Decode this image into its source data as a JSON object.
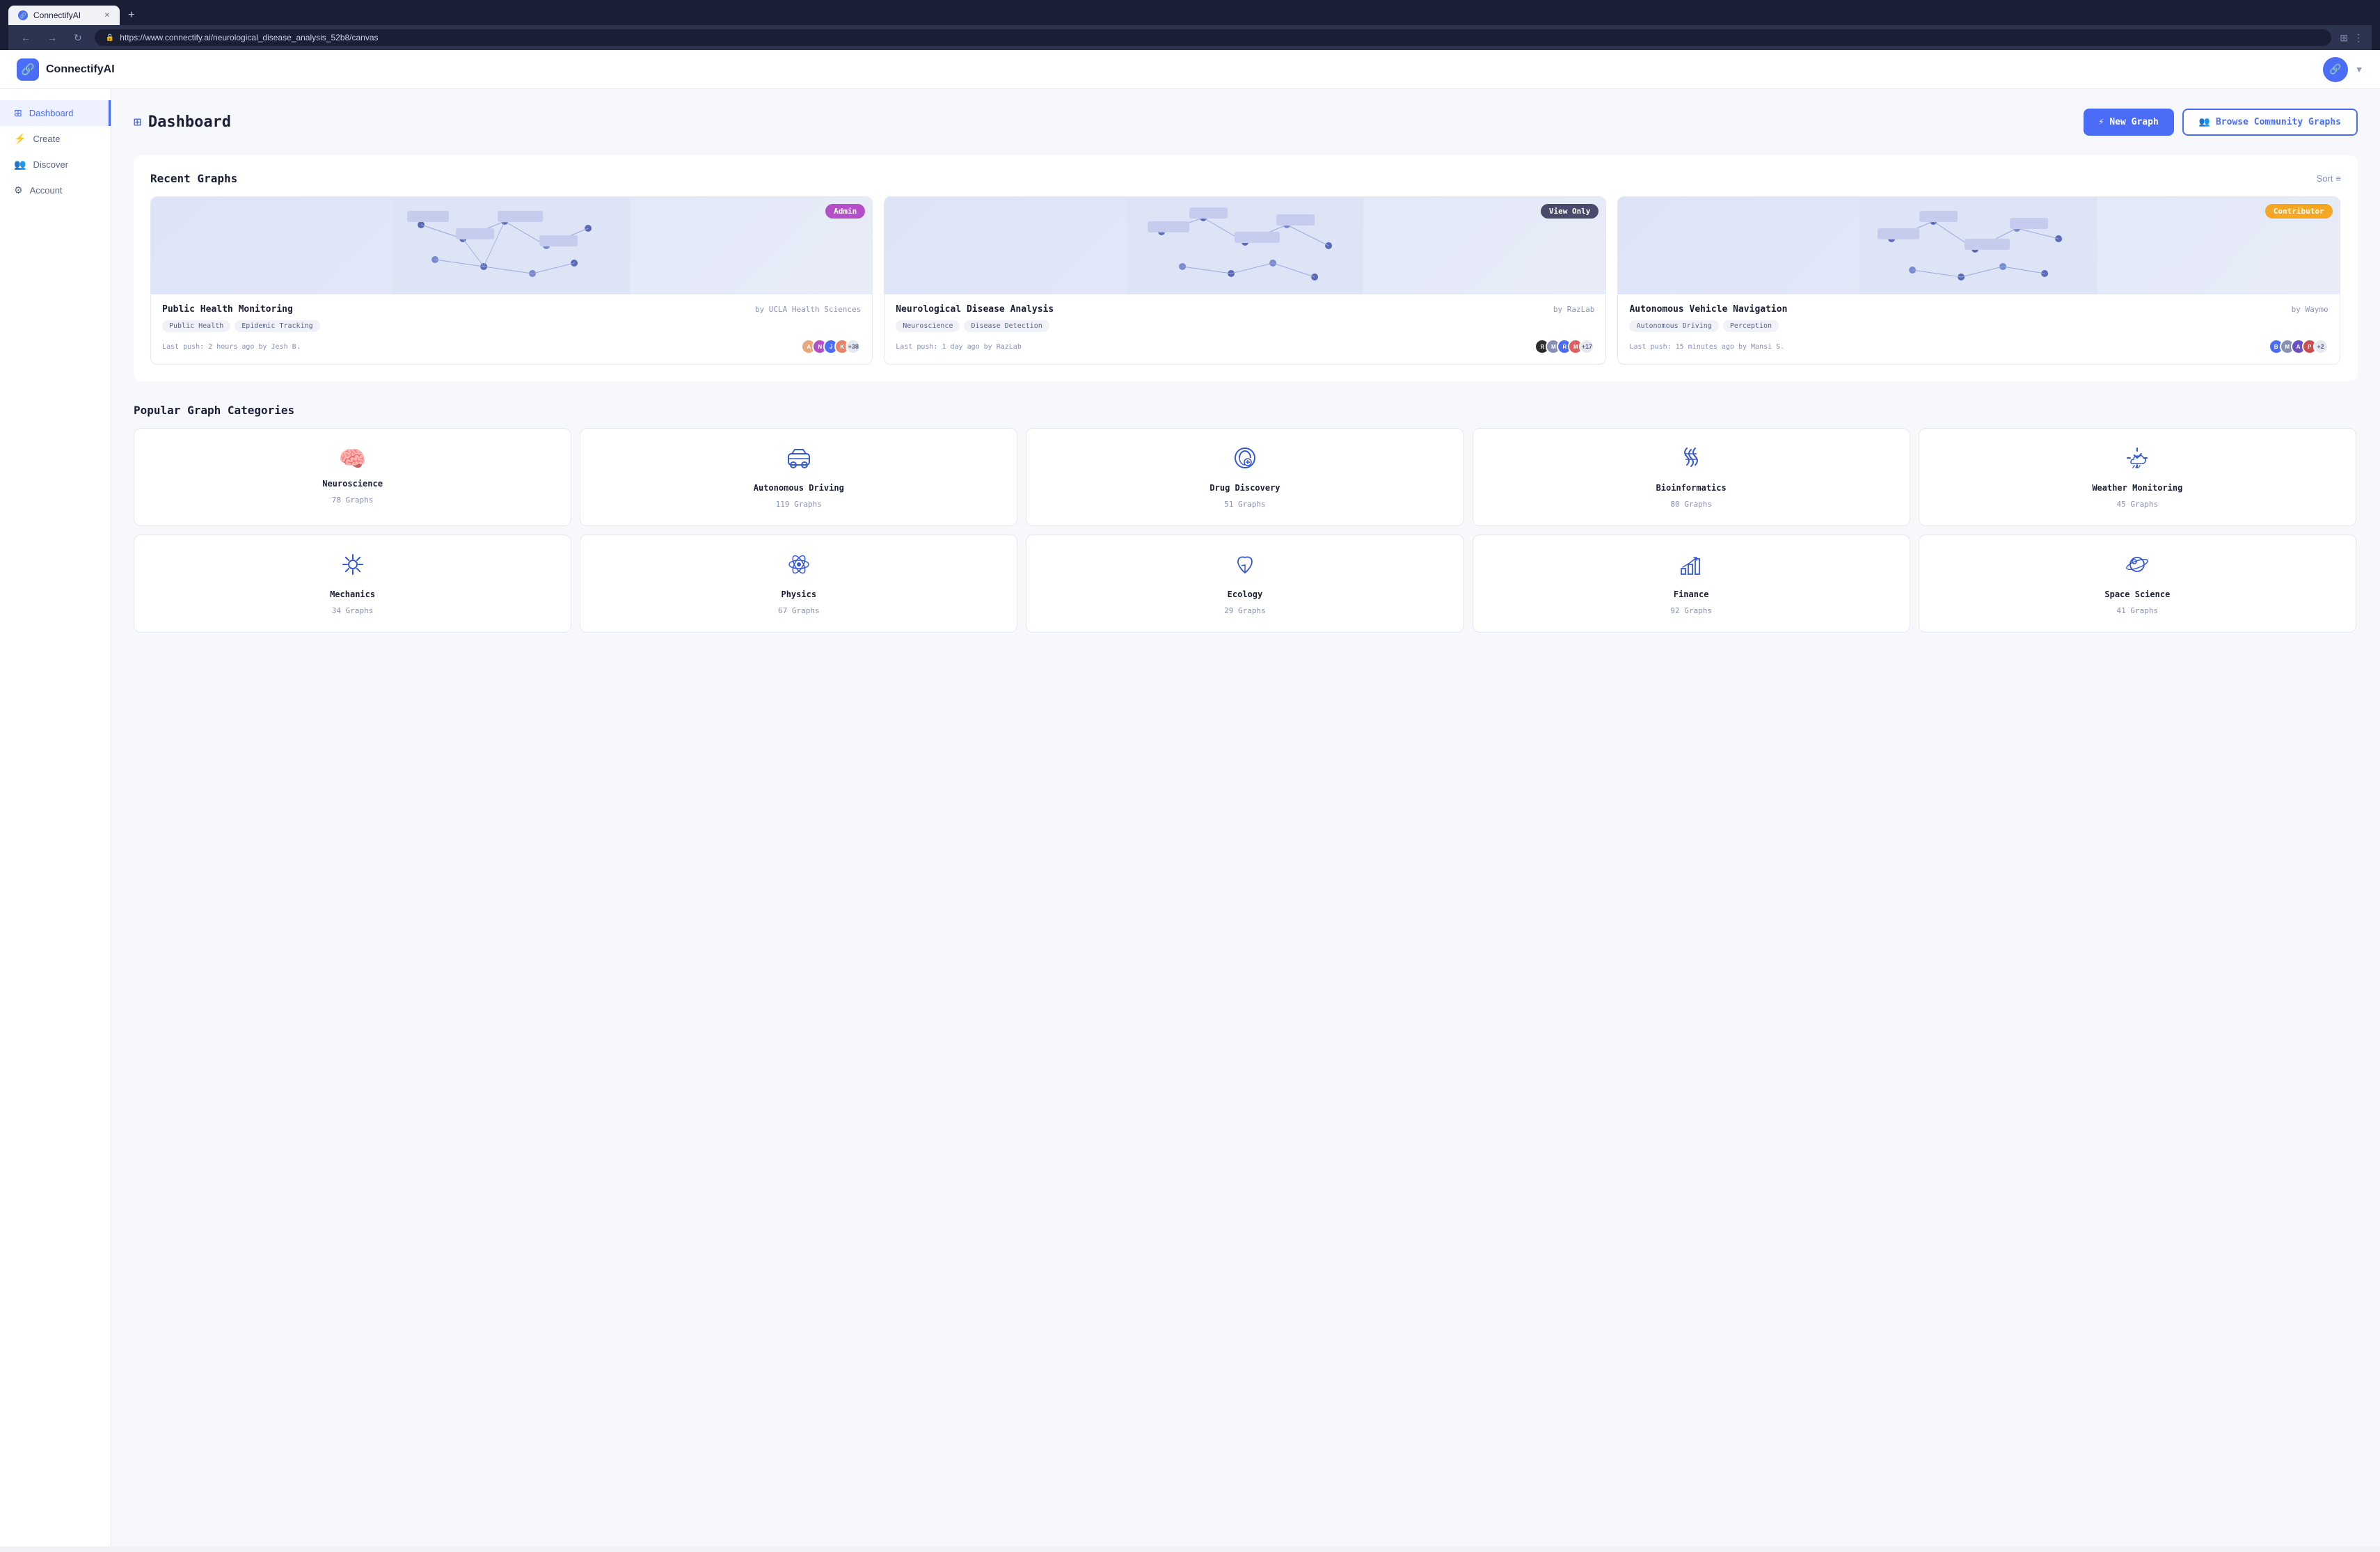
{
  "browser": {
    "tab_title": "ConnectifyAI",
    "url": "https://www.connectify.ai/neurological_disease_analysis_52b8/canvas",
    "new_tab_symbol": "+"
  },
  "app": {
    "name": "ConnectifyAI",
    "logo_symbol": "🔗"
  },
  "sidebar": {
    "items": [
      {
        "id": "dashboard",
        "label": "Dashboard",
        "icon": "⊞",
        "active": true
      },
      {
        "id": "create",
        "label": "Create",
        "icon": "⚡"
      },
      {
        "id": "discover",
        "label": "Discover",
        "icon": "👥"
      },
      {
        "id": "account",
        "label": "Account",
        "icon": "⚙"
      }
    ]
  },
  "dashboard": {
    "title": "Dashboard",
    "title_icon": "⊞",
    "new_graph_label": "New Graph",
    "browse_community_label": "Browse Community Graphs",
    "recent_graphs_title": "Recent Graphs",
    "sort_label": "Sort",
    "popular_categories_title": "Popular Graph Categories"
  },
  "recent_graphs": [
    {
      "id": "graph1",
      "title": "Public Health Monitoring",
      "author": "by UCLA Health Sciences",
      "badge": "Admin",
      "badge_type": "admin",
      "tags": [
        "Public Health",
        "Epidemic Tracking"
      ],
      "push_info": "Last push: 2 hours ago by Jesh B.",
      "avatar_count": "+38",
      "avatars": [
        {
          "color": "#e8a87c",
          "letter": "A"
        },
        {
          "color": "#b44fc7",
          "letter": "N"
        },
        {
          "color": "#4a6cf7",
          "letter": "J"
        },
        {
          "color": "#e8836a",
          "letter": "K"
        }
      ]
    },
    {
      "id": "graph2",
      "title": "Neurological Disease Analysis",
      "author": "by RazLab",
      "badge": "View Only",
      "badge_type": "viewonly",
      "tags": [
        "Neuroscience",
        "Disease Detection"
      ],
      "push_info": "Last push: 1 day ago by RazLab",
      "avatar_count": "+17",
      "avatars": [
        {
          "color": "#2d2d2d",
          "letter": "R"
        },
        {
          "color": "#8890b5",
          "letter": "M"
        },
        {
          "color": "#4a6cf7",
          "letter": "R"
        },
        {
          "color": "#e05f5f",
          "letter": "M"
        }
      ]
    },
    {
      "id": "graph3",
      "title": "Autonomous Vehicle Navigation",
      "author": "by Waymo",
      "badge": "Contributor",
      "badge_type": "contributor",
      "tags": [
        "Autonomous Driving",
        "Perception"
      ],
      "push_info": "Last push: 15 minutes ago by Mansi S.",
      "avatar_count": "+2",
      "avatars": [
        {
          "color": "#4a6cf7",
          "letter": "B"
        },
        {
          "color": "#8890b5",
          "letter": "M"
        },
        {
          "color": "#6b4fc7",
          "letter": "A"
        },
        {
          "color": "#c74f4f",
          "letter": "P"
        }
      ]
    }
  ],
  "categories_row1": [
    {
      "id": "neuroscience",
      "name": "Neuroscience",
      "count": "78 Graphs",
      "icon": "🧠"
    },
    {
      "id": "autonomous",
      "name": "Autonomous Driving",
      "count": "119 Graphs",
      "icon": "🚗"
    },
    {
      "id": "drug",
      "name": "Drug Discovery",
      "count": "51 Graphs",
      "icon": "💊"
    },
    {
      "id": "bioinformatics",
      "name": "Bioinformatics",
      "count": "80 Graphs",
      "icon": "🧬"
    },
    {
      "id": "weather",
      "name": "Weather Monitoring",
      "count": "45 Graphs",
      "icon": "🌿"
    }
  ],
  "categories_row2": [
    {
      "id": "mechanics",
      "name": "Mechanics",
      "count": "34 Graphs",
      "icon": "⚙"
    },
    {
      "id": "physics",
      "name": "Physics",
      "count": "67 Graphs",
      "icon": "⚛"
    },
    {
      "id": "ecology",
      "name": "Ecology",
      "count": "29 Graphs",
      "icon": "🌱"
    },
    {
      "id": "finance",
      "name": "Finance",
      "count": "92 Graphs",
      "icon": "📊"
    },
    {
      "id": "space",
      "name": "Space Science",
      "count": "41 Graphs",
      "icon": "🌍"
    }
  ]
}
